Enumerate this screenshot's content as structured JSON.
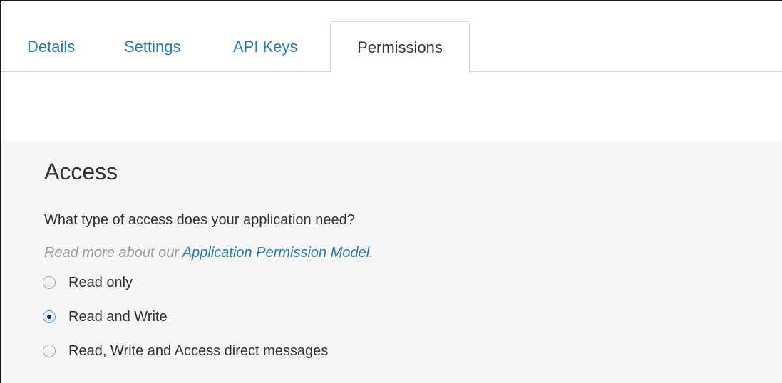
{
  "tabs": [
    {
      "label": "Details",
      "active": false
    },
    {
      "label": "Settings",
      "active": false
    },
    {
      "label": "API Keys",
      "active": false
    },
    {
      "label": "Permissions",
      "active": true
    }
  ],
  "access": {
    "heading": "Access",
    "question": "What type of access does your application need?",
    "read_more_prefix": "Read more about our ",
    "read_more_link": "Application Permission Model",
    "read_more_suffix": ".",
    "options": [
      {
        "label": "Read only",
        "selected": false
      },
      {
        "label": "Read and Write",
        "selected": true
      },
      {
        "label": "Read, Write and Access direct messages",
        "selected": false
      }
    ]
  },
  "colors": {
    "link": "#2a7ab0",
    "panel_background": "#f6f6f6",
    "text": "#333333",
    "muted_text": "#9a9a9a"
  }
}
